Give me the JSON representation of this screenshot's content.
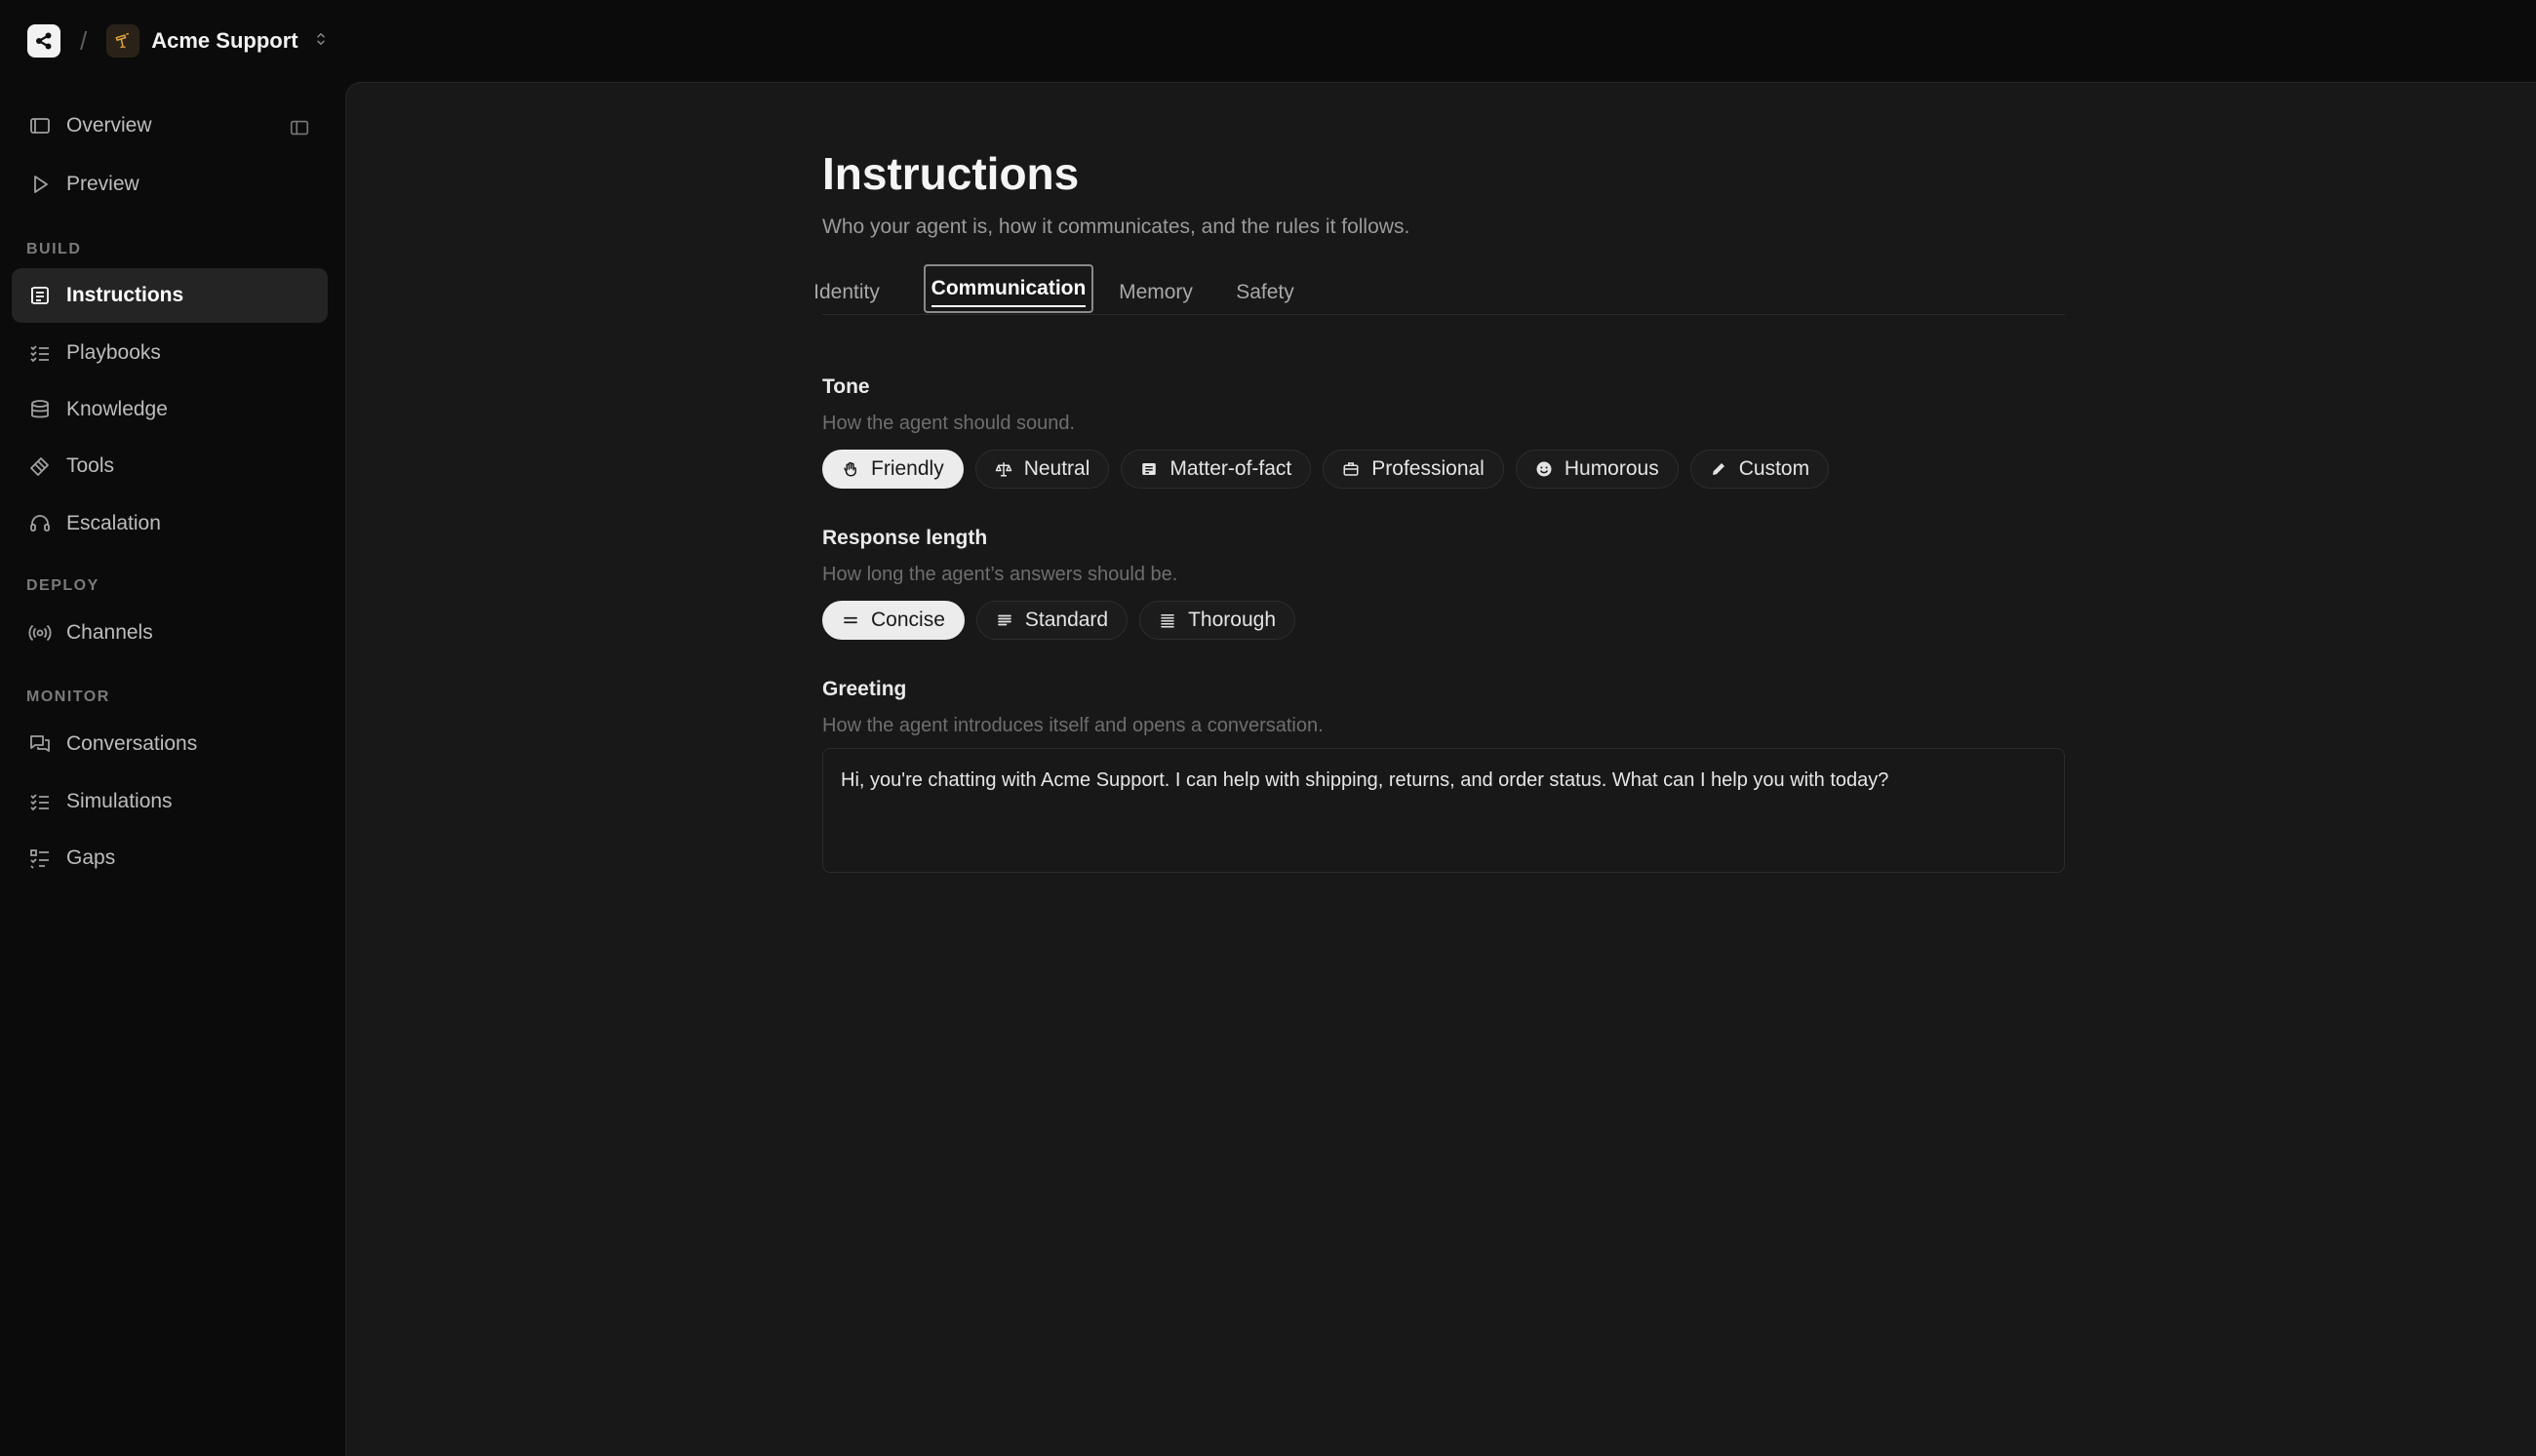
{
  "topbar": {
    "separator": "/",
    "project_name": "Acme Support"
  },
  "sidebar": {
    "top_items": [
      {
        "label": "Overview",
        "icon": "overview-icon"
      },
      {
        "label": "Preview",
        "icon": "play-icon"
      }
    ],
    "sections": [
      {
        "title": "BUILD",
        "items": [
          {
            "label": "Instructions",
            "icon": "instructions-icon",
            "active": true
          },
          {
            "label": "Playbooks",
            "icon": "checklist-icon"
          },
          {
            "label": "Knowledge",
            "icon": "database-icon"
          },
          {
            "label": "Tools",
            "icon": "tools-icon"
          },
          {
            "label": "Escalation",
            "icon": "headset-icon"
          }
        ]
      },
      {
        "title": "DEPLOY",
        "items": [
          {
            "label": "Channels",
            "icon": "broadcast-icon"
          }
        ]
      },
      {
        "title": "MONITOR",
        "items": [
          {
            "label": "Conversations",
            "icon": "chat-icon"
          },
          {
            "label": "Simulations",
            "icon": "checklist-icon"
          },
          {
            "label": "Gaps",
            "icon": "gaps-icon"
          }
        ]
      }
    ]
  },
  "page": {
    "title": "Instructions",
    "subtitle": "Who your agent is, how it communicates, and the rules it follows.",
    "tabs": [
      {
        "label": "Identity"
      },
      {
        "label": "Communication",
        "active": true
      },
      {
        "label": "Memory"
      },
      {
        "label": "Safety"
      }
    ]
  },
  "tone": {
    "label": "Tone",
    "help": "How the agent should sound.",
    "options": [
      {
        "label": "Friendly",
        "icon": "wave-hand-icon",
        "selected": true
      },
      {
        "label": "Neutral",
        "icon": "scale-icon"
      },
      {
        "label": "Matter-of-fact",
        "icon": "document-icon"
      },
      {
        "label": "Professional",
        "icon": "briefcase-icon"
      },
      {
        "label": "Humorous",
        "icon": "smiley-icon"
      },
      {
        "label": "Custom",
        "icon": "pencil-icon"
      }
    ]
  },
  "response_length": {
    "label": "Response length",
    "help": "How long the agent’s answers should be.",
    "options": [
      {
        "label": "Concise",
        "icon": "short-lines-icon",
        "selected": true
      },
      {
        "label": "Standard",
        "icon": "medium-lines-icon"
      },
      {
        "label": "Thorough",
        "icon": "long-lines-icon"
      }
    ]
  },
  "greeting": {
    "label": "Greeting",
    "help": "How the agent introduces itself and opens a conversation.",
    "value": "Hi, you're chatting with Acme Support. I can help with shipping, returns, and order status. What can I help you with today?"
  }
}
